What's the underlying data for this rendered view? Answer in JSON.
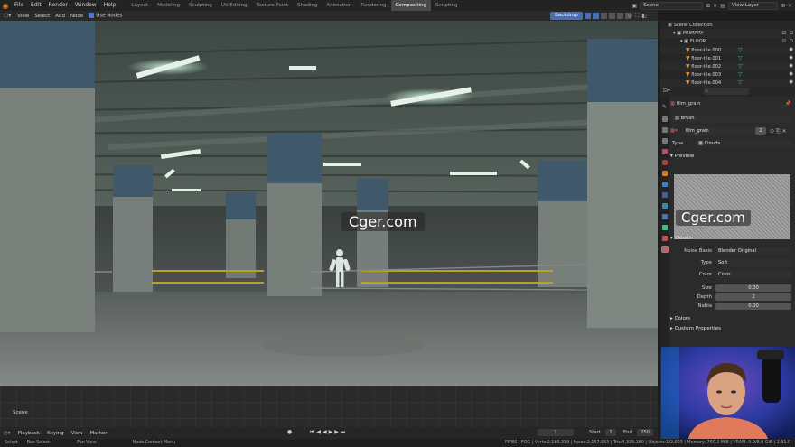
{
  "menu": [
    "File",
    "Edit",
    "Render",
    "Window",
    "Help"
  ],
  "workspaces": [
    "Layout",
    "Modeling",
    "Sculpting",
    "UV Editing",
    "Texture Paint",
    "Shading",
    "Animation",
    "Rendering",
    "Compositing",
    "Scripting"
  ],
  "active_workspace": "Compositing",
  "scene_field": "Scene",
  "view_layer_field": "View Layer",
  "editor_header": {
    "view": "View",
    "select": "Select",
    "add": "Add",
    "node": "Node",
    "use_nodes": "Use Nodes",
    "backdrop": "Backdrop"
  },
  "watermark": "Cger.com",
  "node_scene_label": "Scene",
  "timeline": {
    "playback": "Playback",
    "keying": "Keying",
    "view": "View",
    "marker": "Marker",
    "current_frame": "1",
    "start_label": "Start",
    "start": "1",
    "end_label": "End",
    "end": "250"
  },
  "status_bar": {
    "select": "Select",
    "box_select": "Box Select",
    "pan_view": "Pan View",
    "node_context_menu": "Node Context Menu",
    "stats": "PIPES | FOG | Verts:2,180,319 | Faces:2,157,953 | Tris:4,335,180 | Objects:1/2,003 | Memory: 760.2 MiB | VRAM: 0.9/8.0 GiB | 2.91.0"
  },
  "outliner": {
    "title": "Scene Collection",
    "rows": [
      {
        "label": "PRIMARY",
        "indent": 1
      },
      {
        "label": "FLOOR",
        "indent": 2
      },
      {
        "label": "floor-tile.000",
        "indent": 3
      },
      {
        "label": "floor-tile.001",
        "indent": 3
      },
      {
        "label": "floor-tile.002",
        "indent": 3
      },
      {
        "label": "floor-tile.003",
        "indent": 3
      },
      {
        "label": "floor-tile.004",
        "indent": 3
      }
    ]
  },
  "properties": {
    "texture_name": "film_grain",
    "brush_dropdown": "Brush",
    "datablock_name": "film_grain",
    "users": "2",
    "type_label": "Type",
    "type_value": "Clouds",
    "preview_label": "Preview",
    "clouds_label": "Clouds",
    "noise_basis_label": "Noise Basis",
    "noise_basis_value": "Blender Original",
    "type2_label": "Type",
    "type2_value": "Soft",
    "color_label": "Color",
    "color_value": "Color",
    "size_label": "Size",
    "size_value": "0.00",
    "depth_label": "Depth",
    "depth_value": "2",
    "nabla_label": "Nabla",
    "nabla_value": "0.00",
    "colors_section": "Colors",
    "custom_props_section": "Custom Properties"
  },
  "colors": {
    "accent_blue": "#4a6fb0",
    "active_tab": "#4a4a4a",
    "orange": "#e09040",
    "green": "#3ac08f"
  }
}
